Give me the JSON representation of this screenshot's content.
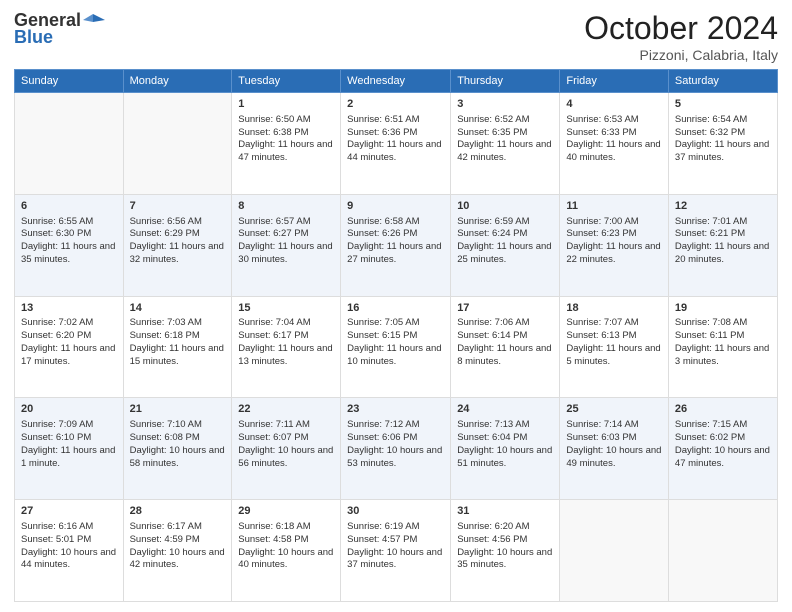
{
  "header": {
    "logo_general": "General",
    "logo_blue": "Blue",
    "month_title": "October 2024",
    "location": "Pizzoni, Calabria, Italy"
  },
  "calendar": {
    "days_of_week": [
      "Sunday",
      "Monday",
      "Tuesday",
      "Wednesday",
      "Thursday",
      "Friday",
      "Saturday"
    ],
    "weeks": [
      [
        {
          "day": "",
          "empty": true
        },
        {
          "day": "",
          "empty": true
        },
        {
          "day": "1",
          "sunrise": "Sunrise: 6:50 AM",
          "sunset": "Sunset: 6:38 PM",
          "daylight": "Daylight: 11 hours and 47 minutes."
        },
        {
          "day": "2",
          "sunrise": "Sunrise: 6:51 AM",
          "sunset": "Sunset: 6:36 PM",
          "daylight": "Daylight: 11 hours and 44 minutes."
        },
        {
          "day": "3",
          "sunrise": "Sunrise: 6:52 AM",
          "sunset": "Sunset: 6:35 PM",
          "daylight": "Daylight: 11 hours and 42 minutes."
        },
        {
          "day": "4",
          "sunrise": "Sunrise: 6:53 AM",
          "sunset": "Sunset: 6:33 PM",
          "daylight": "Daylight: 11 hours and 40 minutes."
        },
        {
          "day": "5",
          "sunrise": "Sunrise: 6:54 AM",
          "sunset": "Sunset: 6:32 PM",
          "daylight": "Daylight: 11 hours and 37 minutes."
        }
      ],
      [
        {
          "day": "6",
          "sunrise": "Sunrise: 6:55 AM",
          "sunset": "Sunset: 6:30 PM",
          "daylight": "Daylight: 11 hours and 35 minutes."
        },
        {
          "day": "7",
          "sunrise": "Sunrise: 6:56 AM",
          "sunset": "Sunset: 6:29 PM",
          "daylight": "Daylight: 11 hours and 32 minutes."
        },
        {
          "day": "8",
          "sunrise": "Sunrise: 6:57 AM",
          "sunset": "Sunset: 6:27 PM",
          "daylight": "Daylight: 11 hours and 30 minutes."
        },
        {
          "day": "9",
          "sunrise": "Sunrise: 6:58 AM",
          "sunset": "Sunset: 6:26 PM",
          "daylight": "Daylight: 11 hours and 27 minutes."
        },
        {
          "day": "10",
          "sunrise": "Sunrise: 6:59 AM",
          "sunset": "Sunset: 6:24 PM",
          "daylight": "Daylight: 11 hours and 25 minutes."
        },
        {
          "day": "11",
          "sunrise": "Sunrise: 7:00 AM",
          "sunset": "Sunset: 6:23 PM",
          "daylight": "Daylight: 11 hours and 22 minutes."
        },
        {
          "day": "12",
          "sunrise": "Sunrise: 7:01 AM",
          "sunset": "Sunset: 6:21 PM",
          "daylight": "Daylight: 11 hours and 20 minutes."
        }
      ],
      [
        {
          "day": "13",
          "sunrise": "Sunrise: 7:02 AM",
          "sunset": "Sunset: 6:20 PM",
          "daylight": "Daylight: 11 hours and 17 minutes."
        },
        {
          "day": "14",
          "sunrise": "Sunrise: 7:03 AM",
          "sunset": "Sunset: 6:18 PM",
          "daylight": "Daylight: 11 hours and 15 minutes."
        },
        {
          "day": "15",
          "sunrise": "Sunrise: 7:04 AM",
          "sunset": "Sunset: 6:17 PM",
          "daylight": "Daylight: 11 hours and 13 minutes."
        },
        {
          "day": "16",
          "sunrise": "Sunrise: 7:05 AM",
          "sunset": "Sunset: 6:15 PM",
          "daylight": "Daylight: 11 hours and 10 minutes."
        },
        {
          "day": "17",
          "sunrise": "Sunrise: 7:06 AM",
          "sunset": "Sunset: 6:14 PM",
          "daylight": "Daylight: 11 hours and 8 minutes."
        },
        {
          "day": "18",
          "sunrise": "Sunrise: 7:07 AM",
          "sunset": "Sunset: 6:13 PM",
          "daylight": "Daylight: 11 hours and 5 minutes."
        },
        {
          "day": "19",
          "sunrise": "Sunrise: 7:08 AM",
          "sunset": "Sunset: 6:11 PM",
          "daylight": "Daylight: 11 hours and 3 minutes."
        }
      ],
      [
        {
          "day": "20",
          "sunrise": "Sunrise: 7:09 AM",
          "sunset": "Sunset: 6:10 PM",
          "daylight": "Daylight: 11 hours and 1 minute."
        },
        {
          "day": "21",
          "sunrise": "Sunrise: 7:10 AM",
          "sunset": "Sunset: 6:08 PM",
          "daylight": "Daylight: 10 hours and 58 minutes."
        },
        {
          "day": "22",
          "sunrise": "Sunrise: 7:11 AM",
          "sunset": "Sunset: 6:07 PM",
          "daylight": "Daylight: 10 hours and 56 minutes."
        },
        {
          "day": "23",
          "sunrise": "Sunrise: 7:12 AM",
          "sunset": "Sunset: 6:06 PM",
          "daylight": "Daylight: 10 hours and 53 minutes."
        },
        {
          "day": "24",
          "sunrise": "Sunrise: 7:13 AM",
          "sunset": "Sunset: 6:04 PM",
          "daylight": "Daylight: 10 hours and 51 minutes."
        },
        {
          "day": "25",
          "sunrise": "Sunrise: 7:14 AM",
          "sunset": "Sunset: 6:03 PM",
          "daylight": "Daylight: 10 hours and 49 minutes."
        },
        {
          "day": "26",
          "sunrise": "Sunrise: 7:15 AM",
          "sunset": "Sunset: 6:02 PM",
          "daylight": "Daylight: 10 hours and 47 minutes."
        }
      ],
      [
        {
          "day": "27",
          "sunrise": "Sunrise: 6:16 AM",
          "sunset": "Sunset: 5:01 PM",
          "daylight": "Daylight: 10 hours and 44 minutes."
        },
        {
          "day": "28",
          "sunrise": "Sunrise: 6:17 AM",
          "sunset": "Sunset: 4:59 PM",
          "daylight": "Daylight: 10 hours and 42 minutes."
        },
        {
          "day": "29",
          "sunrise": "Sunrise: 6:18 AM",
          "sunset": "Sunset: 4:58 PM",
          "daylight": "Daylight: 10 hours and 40 minutes."
        },
        {
          "day": "30",
          "sunrise": "Sunrise: 6:19 AM",
          "sunset": "Sunset: 4:57 PM",
          "daylight": "Daylight: 10 hours and 37 minutes."
        },
        {
          "day": "31",
          "sunrise": "Sunrise: 6:20 AM",
          "sunset": "Sunset: 4:56 PM",
          "daylight": "Daylight: 10 hours and 35 minutes."
        },
        {
          "day": "",
          "empty": true
        },
        {
          "day": "",
          "empty": true
        }
      ]
    ]
  }
}
